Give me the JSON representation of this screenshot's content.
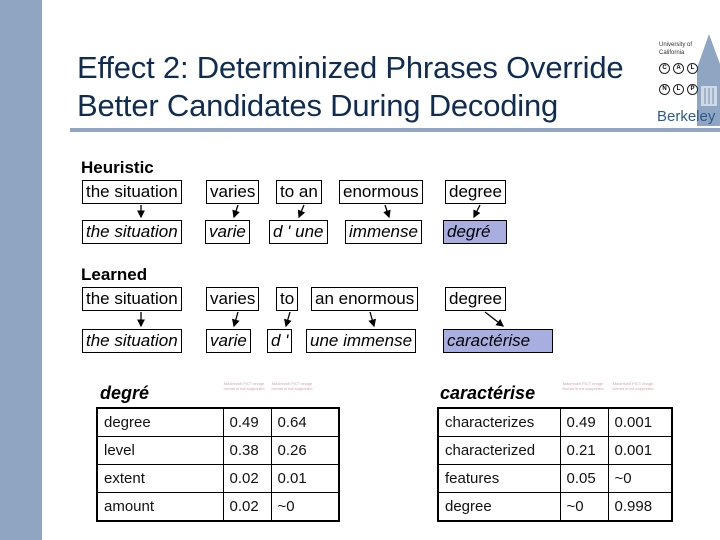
{
  "slide": {
    "title_line1": "Effect 2: Determinized Phrases Override",
    "title_line2": "Better Candidates During Decoding",
    "logo": {
      "line1": "University of",
      "line2": "California",
      "nodes": [
        "C",
        "A",
        "L",
        "N",
        "L",
        "P"
      ],
      "wordmark": "Berkeley"
    },
    "colors": {
      "accent_bar": "#8fa6c2",
      "title": "#0f2d52",
      "highlight": "#a8aee0"
    }
  },
  "heuristic": {
    "label": "Heuristic",
    "source": [
      "the situation",
      "varies",
      "to an",
      "enormous",
      "degree"
    ],
    "target": [
      "the situation",
      "varie",
      "d ' une",
      "immense",
      "degré"
    ],
    "highlighted_target": "degré"
  },
  "learned": {
    "label": "Learned",
    "source": [
      "the situation",
      "varies",
      "to",
      "an enormous",
      "degree"
    ],
    "target": [
      "the situation",
      "varie",
      "d '",
      "une immense",
      "caractérise"
    ],
    "highlighted_target": "caractérise"
  },
  "tables": [
    {
      "title": "degré",
      "header_placeholders": [
        "Macintosh PICT image format is not supported",
        "Macintosh PICT image format is not supported"
      ],
      "rows": [
        [
          "degree",
          "0.49",
          "0.64"
        ],
        [
          "level",
          "0.38",
          "0.26"
        ],
        [
          "extent",
          "0.02",
          "0.01"
        ],
        [
          "amount",
          "0.02",
          "~0"
        ]
      ]
    },
    {
      "title": "caractérise",
      "header_placeholders": [
        "Macintosh PICT image format is not supported",
        "Macintosh PICT image format is not supported"
      ],
      "rows": [
        [
          "characterizes",
          "0.49",
          "0.001"
        ],
        [
          "characterized",
          "0.21",
          "0.001"
        ],
        [
          "features",
          "0.05",
          "~0"
        ],
        [
          "degree",
          "~0",
          "0.998"
        ]
      ]
    }
  ]
}
